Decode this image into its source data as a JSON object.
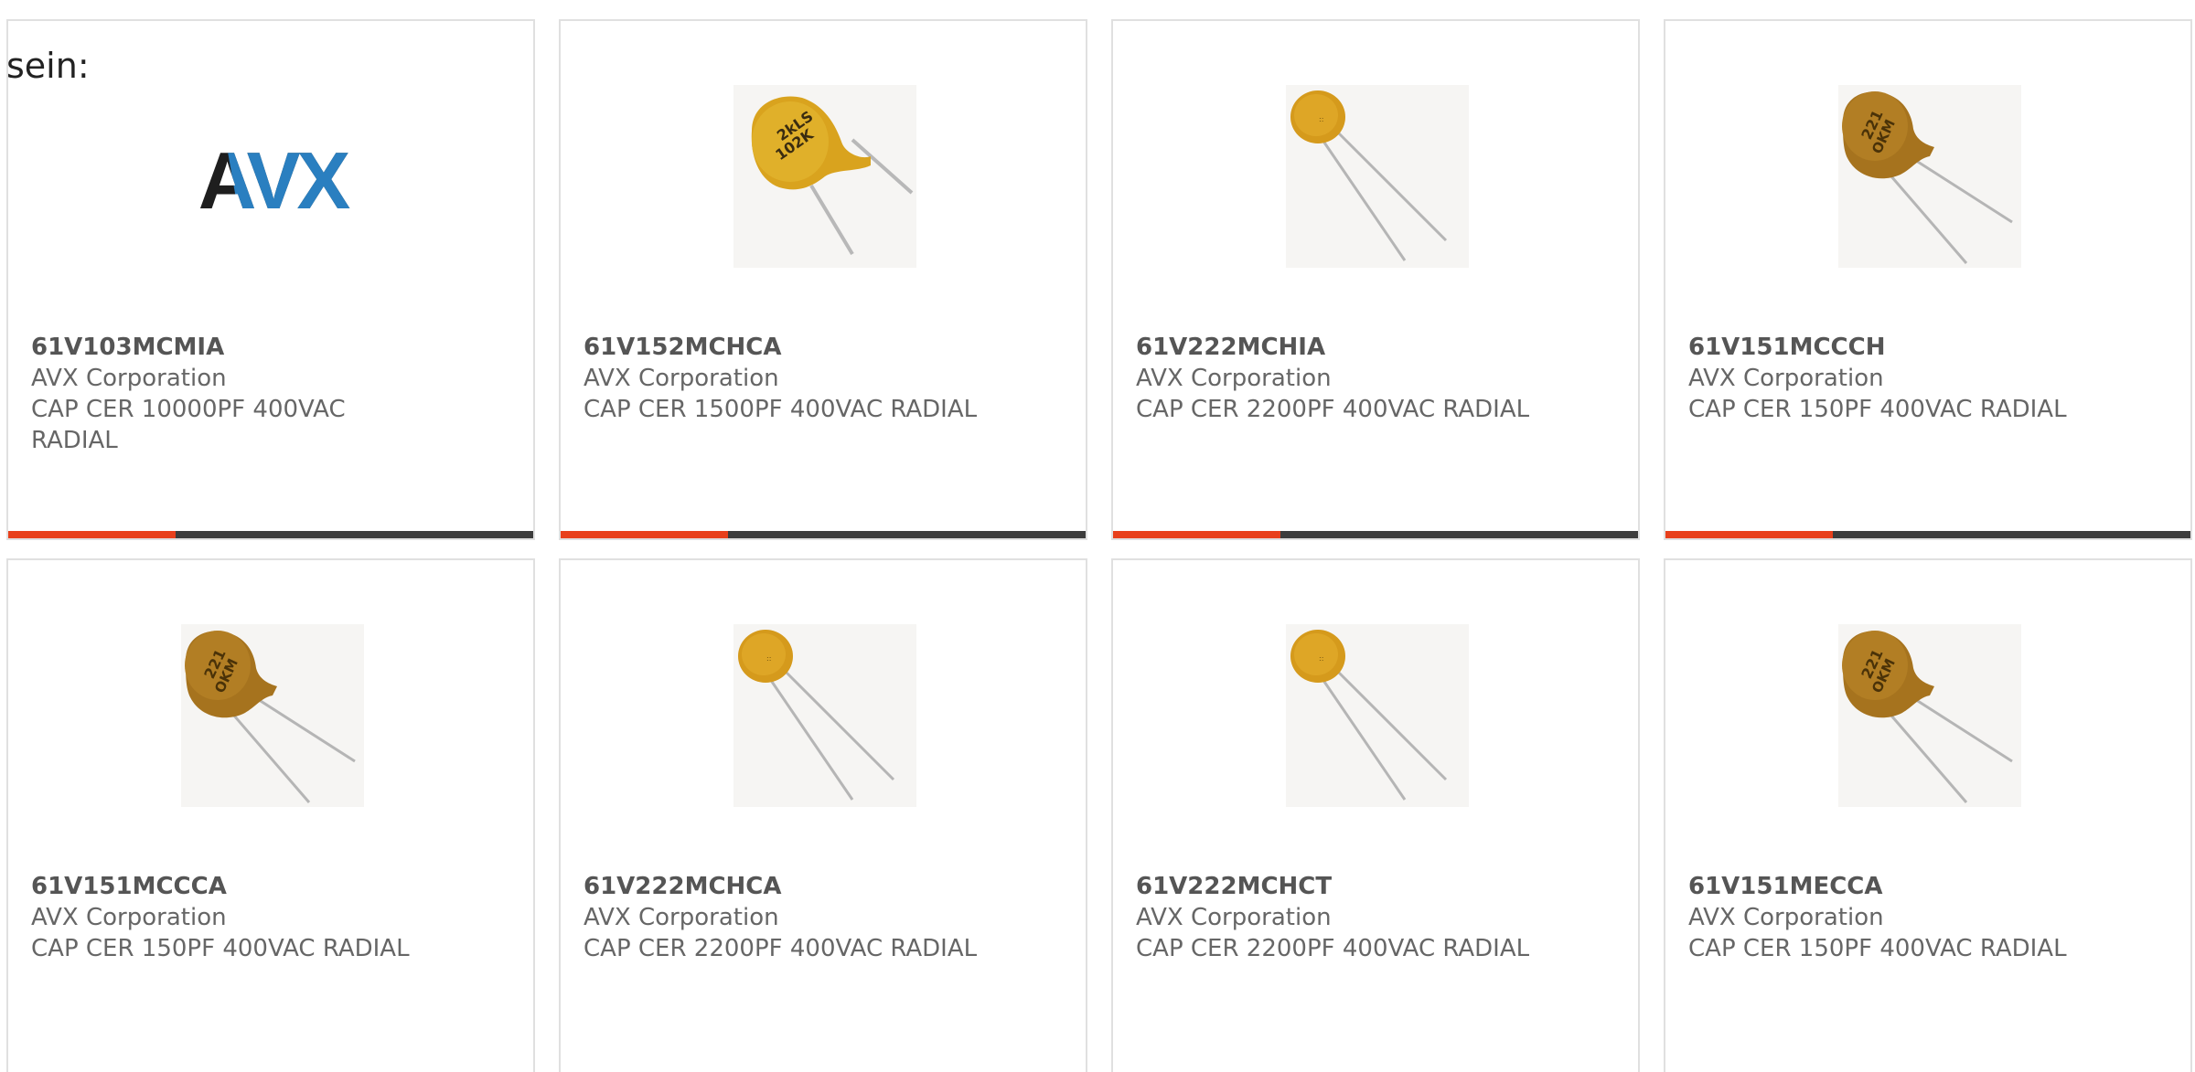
{
  "leading_text": "sein:",
  "products": [
    {
      "part_number": "61V103MCMIA",
      "manufacturer": "AVX Corporation",
      "description": "CAP CER 10000PF 400VAC RADIAL",
      "image": "avx-logo"
    },
    {
      "part_number": "61V152MCHCA",
      "manufacturer": "AVX Corporation",
      "description": "CAP CER 1500PF 400VAC RADIAL",
      "image": "capacitor-photo",
      "marking": [
        "2kLS",
        "102K"
      ]
    },
    {
      "part_number": "61V222MCHIA",
      "manufacturer": "AVX Corporation",
      "description": "CAP CER 2200PF 400VAC RADIAL",
      "image": "capacitor-photo"
    },
    {
      "part_number": "61V151MCCCH",
      "manufacturer": "AVX Corporation",
      "description": "CAP CER 150PF 400VAC RADIAL",
      "image": "capacitor-photo",
      "marking": [
        "221",
        "OKM"
      ]
    },
    {
      "part_number": "61V151MCCCA",
      "manufacturer": "AVX Corporation",
      "description": "CAP CER 150PF 400VAC RADIAL",
      "image": "capacitor-photo",
      "marking": [
        "221",
        "OKM"
      ]
    },
    {
      "part_number": "61V222MCHCA",
      "manufacturer": "AVX Corporation",
      "description": "CAP CER 2200PF 400VAC RADIAL",
      "image": "capacitor-photo"
    },
    {
      "part_number": "61V222MCHCT",
      "manufacturer": "AVX Corporation",
      "description": "CAP CER 2200PF 400VAC RADIAL",
      "image": "capacitor-photo"
    },
    {
      "part_number": "61V151MECCA",
      "manufacturer": "AVX Corporation",
      "description": "CAP CER 150PF 400VAC RADIAL",
      "image": "capacitor-photo",
      "marking": [
        "221",
        "OKM"
      ]
    }
  ],
  "logo": {
    "text": "AVX",
    "colors": {
      "dark": "#1e1e1e",
      "blue": "#2a7fc0"
    }
  },
  "colors": {
    "accent": "#e8401c",
    "bar": "#3c3c3c",
    "border": "#e0e0e0",
    "text": "#666666"
  }
}
